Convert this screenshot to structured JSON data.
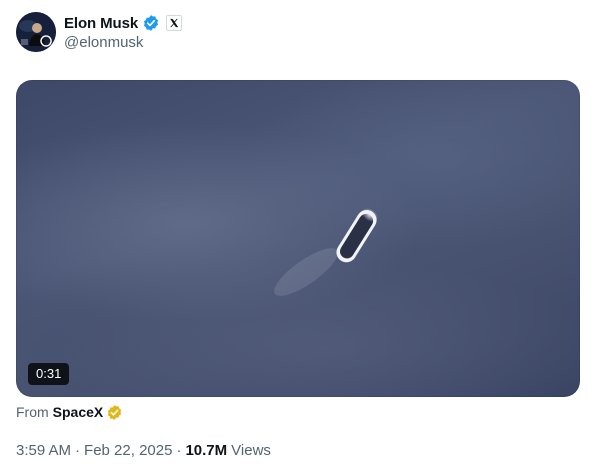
{
  "author": {
    "display_name": "Elon Musk",
    "handle": "@elonmusk",
    "avatar_icon": "profile-photo",
    "verified_icon": "blue-verified-badge",
    "affiliation_icon": "x-logo-badge"
  },
  "media": {
    "type": "video",
    "duration": "0:31"
  },
  "source": {
    "prefix": "From",
    "name": "SpaceX",
    "badge_icon": "gold-verified-badge"
  },
  "meta": {
    "time": "3:59 AM",
    "separator": "·",
    "date": "Feb 22, 2025",
    "views_count": "10.7M",
    "views_label": "Views"
  },
  "colors": {
    "verified_blue": "#1d9bf0",
    "gold_badge": "#e2b719",
    "secondary_text": "#536471",
    "primary_text": "#0f1419"
  }
}
